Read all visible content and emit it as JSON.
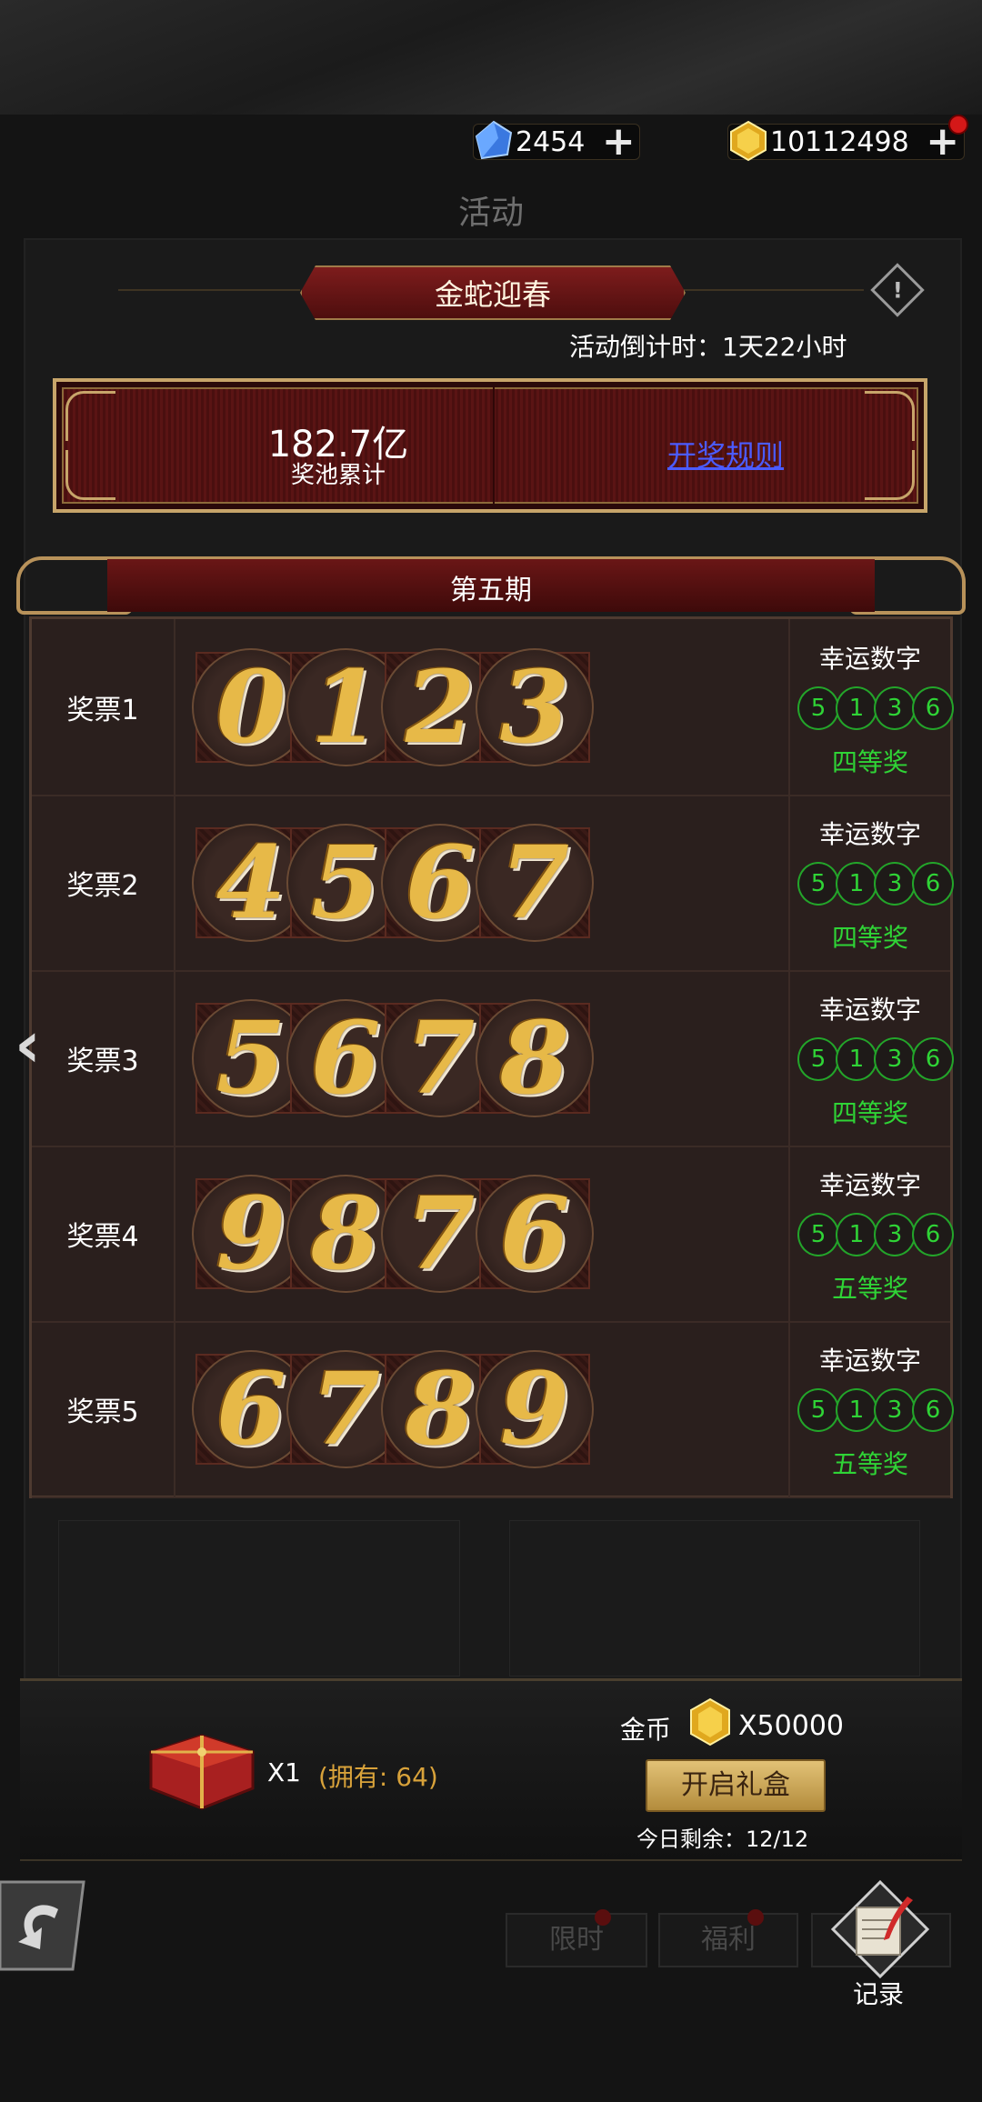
{
  "currency": {
    "gems": "2454",
    "coins": "10112498"
  },
  "page": {
    "title": "活动"
  },
  "event": {
    "title": "金蛇迎春",
    "countdown": "活动倒计时：1天22小时"
  },
  "pool": {
    "value": "182.7亿",
    "label": "奖池累计",
    "rules_link": "开奖规则"
  },
  "period": {
    "title": "第五期"
  },
  "tickets": [
    {
      "label": "奖票1",
      "digits": [
        "0",
        "1",
        "2",
        "3"
      ],
      "lucky_title": "幸运数字",
      "lucky": [
        "5",
        "1",
        "3",
        "6"
      ],
      "prize": "四等奖"
    },
    {
      "label": "奖票2",
      "digits": [
        "4",
        "5",
        "6",
        "7"
      ],
      "lucky_title": "幸运数字",
      "lucky": [
        "5",
        "1",
        "3",
        "6"
      ],
      "prize": "四等奖"
    },
    {
      "label": "奖票3",
      "digits": [
        "5",
        "6",
        "7",
        "8"
      ],
      "lucky_title": "幸运数字",
      "lucky": [
        "5",
        "1",
        "3",
        "6"
      ],
      "prize": "四等奖"
    },
    {
      "label": "奖票4",
      "digits": [
        "9",
        "8",
        "7",
        "6"
      ],
      "lucky_title": "幸运数字",
      "lucky": [
        "5",
        "1",
        "3",
        "6"
      ],
      "prize": "五等奖"
    },
    {
      "label": "奖票5",
      "digits": [
        "6",
        "7",
        "8",
        "9"
      ],
      "lucky_title": "幸运数字",
      "lucky": [
        "5",
        "1",
        "3",
        "6"
      ],
      "prize": "五等奖"
    }
  ],
  "giftbox": {
    "qty": "X1",
    "owned": "(拥有: 64)",
    "cost_label": "金币",
    "cost": "X50000",
    "open_button": "开启礼盒",
    "remaining": "今日剩余：12/12"
  },
  "nav": {
    "tab_limited": "限时",
    "tab_welfare": "福利",
    "record": "记录"
  },
  "colors": {
    "accent_gold": "#e7b948",
    "lucky_green": "#2fd436",
    "link_blue": "#4b5bff"
  }
}
